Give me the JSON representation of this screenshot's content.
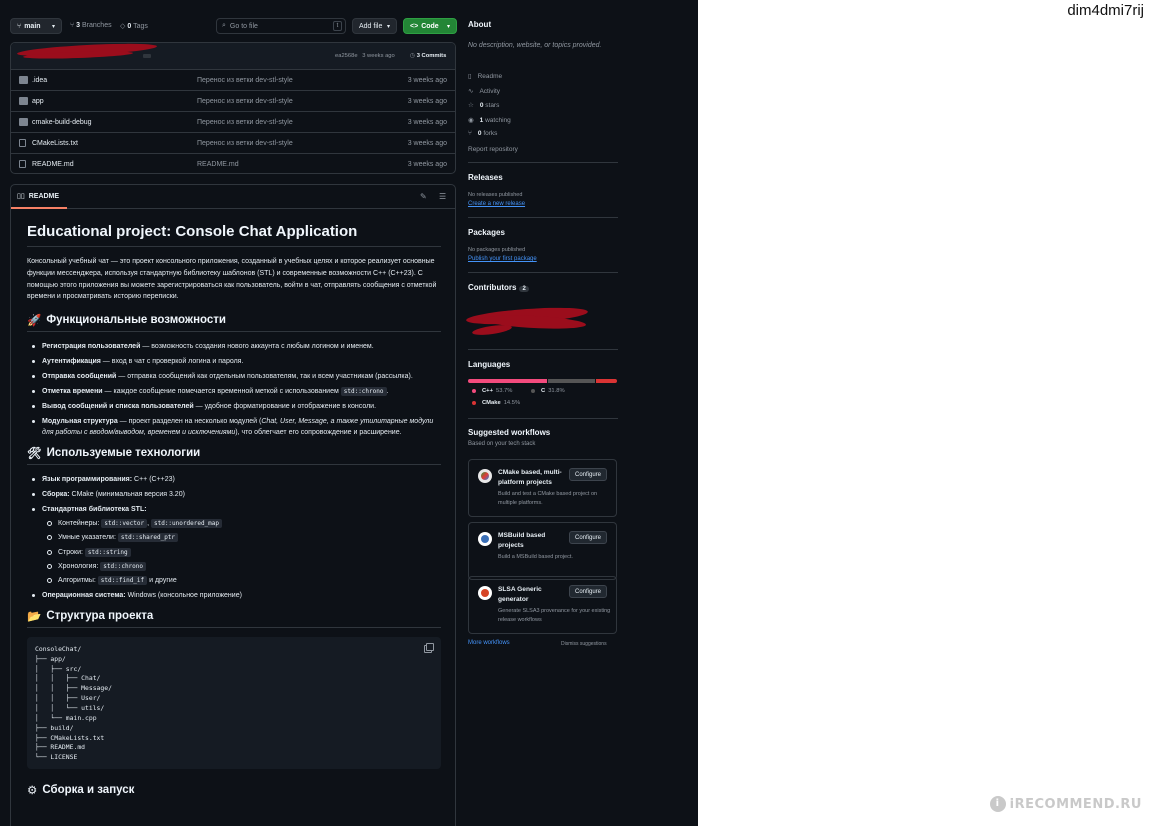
{
  "corner_username": "dim4dmi7rij",
  "watermark": "iRECOMMEND.RU",
  "toolbar": {
    "branch": "main",
    "branches_count": "3",
    "branches_label": "Branches",
    "tags_count": "0",
    "tags_label": "Tags",
    "search_placeholder": "Go to file",
    "search_shortcut": "t",
    "add_file": "Add file",
    "code": "Code"
  },
  "commit": {
    "hash": "ea2568e",
    "age": "3 weeks ago",
    "commits_label": "3 Commits"
  },
  "files": [
    {
      "type": "folder",
      "name": ".idea",
      "message": "Перенос из ветки dev-stl-style",
      "age": "3 weeks ago"
    },
    {
      "type": "folder",
      "name": "app",
      "message": "Перенос из ветки dev-stl-style",
      "age": "3 weeks ago"
    },
    {
      "type": "folder",
      "name": "cmake-build-debug",
      "message": "Перенос из ветки dev-stl-style",
      "age": "3 weeks ago"
    },
    {
      "type": "file",
      "name": "CMakeLists.txt",
      "message": "Перенос из ветки dev-stl-style",
      "age": "3 weeks ago"
    },
    {
      "type": "file",
      "name": "README.md",
      "message": "README.md",
      "age": "3 weeks ago"
    }
  ],
  "readme": {
    "tab": "README",
    "title": "Educational project: Console Chat Application",
    "intro": "Консольный учебный чат — это проект консольного приложения, созданный в учебных целях и которое реализует основные функции мессенджера, используя стандартную библиотеку шаблонов (STL) и современные возможности C++ (C++23). С помощью этого приложения вы можете зарегистрироваться как пользователь, войти в чат, отправлять сообщения с отметкой времени и просматривать историю переписки.",
    "features_heading": "Функциональные возможности",
    "features": [
      {
        "bold": "Регистрация пользователей",
        "text": " — возможность создания нового аккаунта с любым логином и именем."
      },
      {
        "bold": "Аутентификация",
        "text": " — вход в чат с проверкой логина и пароля."
      },
      {
        "bold": "Отправка сообщений",
        "text": " — отправка сообщений как отдельным пользователям, так и всем участникам (рассылка)."
      },
      {
        "bold": "Отметка времени",
        "text": " — каждое сообщение помечается временной меткой с использованием ",
        "code": "std::chrono",
        "after": "."
      },
      {
        "bold": "Вывод сообщений и списка пользователей",
        "text": " — удобное форматирование и отображение в консоли."
      },
      {
        "bold": "Модульная структура",
        "text": " — проект разделен на несколько модулей (",
        "italic": "Chat, User, Message, а также утилитарные модули для работы с вводом/выводом, временем и исключениями",
        "after": "), что облегчает его сопровождение и расширение."
      }
    ],
    "tech_heading": "Используемые технологии",
    "tech": {
      "lang_bold": "Язык программирования:",
      "lang_val": " C++ (C++23)",
      "build_bold": "Сборка:",
      "build_val": " CMake (минимальная версия 3.20)",
      "stl_bold": "Стандартная библиотека STL:",
      "stl_items": [
        {
          "label": "Контейнеры: ",
          "codes": [
            "std::vector",
            "std::unordered_map"
          ],
          "sep": ", ",
          "after": ""
        },
        {
          "label": "Умные указатели: ",
          "codes": [
            "std::shared_ptr"
          ],
          "sep": "",
          "after": ""
        },
        {
          "label": "Строки: ",
          "codes": [
            "std::string"
          ],
          "sep": "",
          "after": ""
        },
        {
          "label": "Хронология: ",
          "codes": [
            "std::chrono"
          ],
          "sep": "",
          "after": ""
        },
        {
          "label": "Алгоритмы: ",
          "codes": [
            "std::find_if"
          ],
          "sep": "",
          "after": " и другие"
        }
      ],
      "os_bold": "Операционная система:",
      "os_val": " Windows (консольное приложение)"
    },
    "structure_heading": "Структура проекта",
    "tree": "ConsoleChat/\n├── app/\n│   ├── src/\n│   │   ├── Chat/\n│   │   ├── Message/\n│   │   ├── User/\n│   │   └── utils/\n│   └── main.cpp\n├── build/\n├── CMakeLists.txt\n├── README.md\n└── LICENSE",
    "build_heading": "Сборка и запуск"
  },
  "sidebar": {
    "about_heading": "About",
    "about_desc": "No description, website, or topics provided.",
    "readme_link": "Readme",
    "activity_link": "Activity",
    "stars_count": "0",
    "stars_label": "stars",
    "watching_count": "1",
    "watching_label": "watching",
    "forks_count": "0",
    "forks_label": "forks",
    "report": "Report repository",
    "releases_heading": "Releases",
    "releases_none": "No releases published",
    "releases_link": "Create a new release",
    "packages_heading": "Packages",
    "packages_none": "No packages published",
    "packages_link": "Publish your first package",
    "contributors_heading": "Contributors",
    "contributors_count": "2",
    "languages_heading": "Languages",
    "languages": [
      {
        "name": "C++",
        "percent": "53.7%",
        "value": 53.7,
        "color": "#f34b7d"
      },
      {
        "name": "C",
        "percent": "31.8%",
        "value": 31.8,
        "color": "#555555"
      },
      {
        "name": "CMake",
        "percent": "14.5%",
        "value": 14.5,
        "color": "#da3434"
      }
    ],
    "workflows_heading": "Suggested workflows",
    "workflows_sub": "Based on your tech stack",
    "workflows": [
      {
        "title": "CMake based, multi-platform projects",
        "desc": "Build and test a CMake based project on multiple platforms.",
        "button": "Configure",
        "icon": "cmake-icon"
      },
      {
        "title": "MSBuild based projects",
        "desc": "Build a MSBuild based project.",
        "button": "Configure",
        "icon": "msbuild-icon"
      },
      {
        "title": "SLSA Generic generator",
        "desc": "Generate SLSA3 provenance for your existing release workflows",
        "button": "Configure",
        "icon": "slsa-icon"
      }
    ],
    "more_workflows": "More workflows",
    "dismiss": "Dismiss suggestions"
  },
  "colors": {
    "bg": "#0d1117",
    "accent_green": "#238636",
    "link": "#4493f8",
    "redaction": "#9b0d1c"
  }
}
